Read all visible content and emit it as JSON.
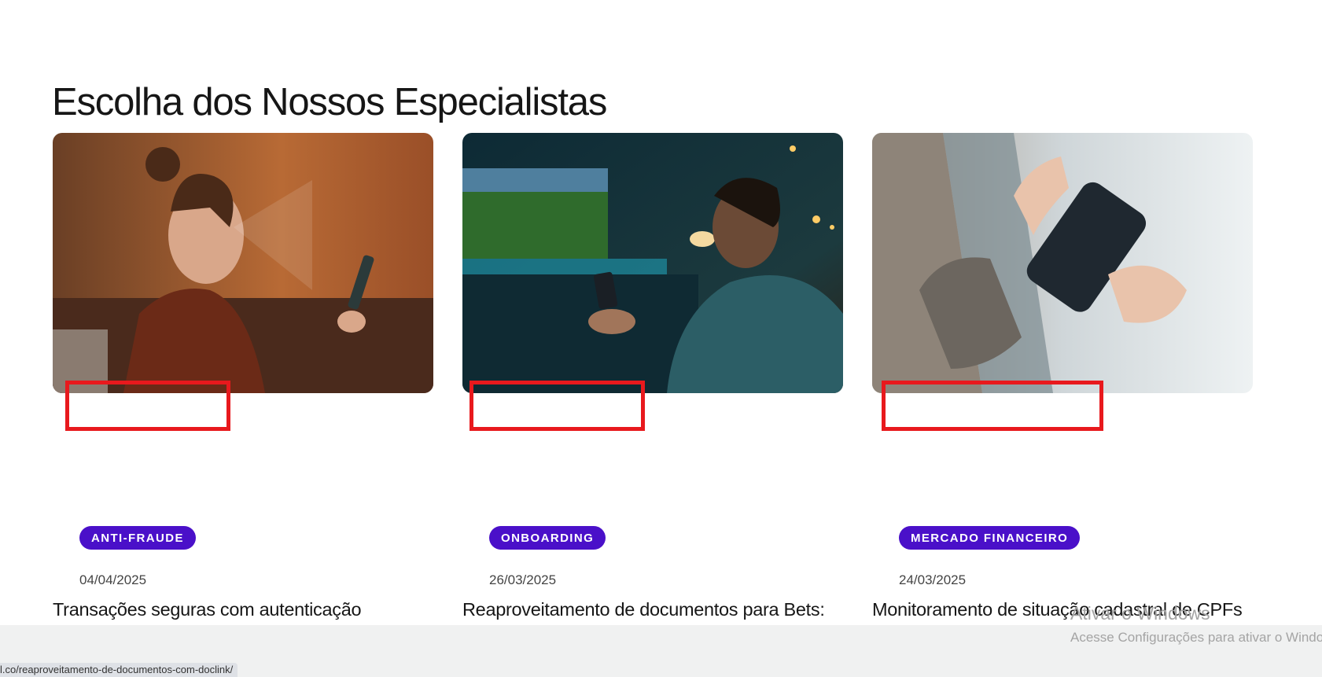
{
  "section": {
    "title": "Escolha dos Nossos Especialistas"
  },
  "cards": [
    {
      "image_alt": "woman with biometric face mesh looking at phone",
      "tag": "ANTI-FRAUDE",
      "date": "04/04/2025",
      "title": "Transações seguras com autenticação biométrica: Face Match, Liveness e Facelink"
    },
    {
      "image_alt": "man watching football on TV holding phone",
      "tag": "ONBOARDING",
      "date": "26/03/2025",
      "title": "Reaproveitamento de documentos para Bets: entenda como o Doclink da idwall acelera a conversão em onboarding"
    },
    {
      "image_alt": "hands holding smartphone",
      "tag": "MERCADO FINANCEIRO",
      "date": "24/03/2025",
      "title": "Monitoramento de situação cadastral de CPFs e CNPJs: como a idwall ajuda sua operação?"
    }
  ],
  "windows_watermark": {
    "title": "Ativar o Windows",
    "subtitle": "Acesse Configurações para ativar o Windows."
  },
  "status_bar": {
    "url": "l.co/reaproveitamento-de-documentos-com-doclink/"
  },
  "colors": {
    "tag_bg": "#4a10c9",
    "highlight": "#e8191d"
  }
}
